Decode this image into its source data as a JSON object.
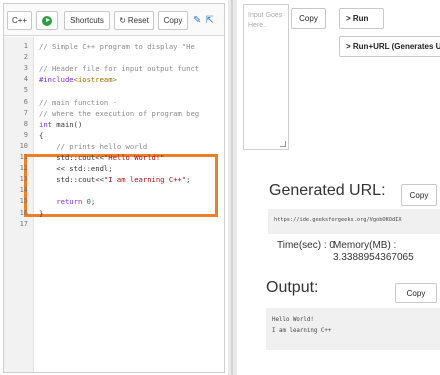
{
  "editor": {
    "toolbar": {
      "language_label": "C++",
      "shortcuts_label": "Shortcuts",
      "reset_label": "Reset",
      "copy_label": "Copy"
    },
    "lines": [
      {
        "num": "1",
        "text": "// Simple C++ program to display \"He"
      },
      {
        "num": "2",
        "text": ""
      },
      {
        "num": "3",
        "text": "// Header file for input output funct"
      },
      {
        "num": "4",
        "text": "#include<iostream>"
      },
      {
        "num": "5",
        "text": ""
      },
      {
        "num": "6",
        "text": "// main function -"
      },
      {
        "num": "7",
        "text": "// where the execution of program beg"
      },
      {
        "num": "8",
        "text": "int main()"
      },
      {
        "num": "9",
        "text": "{"
      },
      {
        "num": "10",
        "text": "    // prints hello world"
      },
      {
        "num": "11",
        "text": "    std::cout<<\"Hello World!\""
      },
      {
        "num": "12",
        "text": "    << std::endl;"
      },
      {
        "num": "13",
        "text": "    std::cout<<\"I am learning C++\";"
      },
      {
        "num": "14",
        "text": ""
      },
      {
        "num": "15",
        "text": "    return 0;"
      },
      {
        "num": "16",
        "text": "}"
      },
      {
        "num": "17",
        "text": ""
      }
    ]
  },
  "input": {
    "placeholder": "Input Goes Here..",
    "copy_label": "Copy"
  },
  "run": {
    "run_label": "> Run",
    "run_url_label": "> Run+URL (Generates U"
  },
  "generated_url": {
    "title": "Generated URL:",
    "copy_label": "Copy",
    "url": "https://ide.geeksforgeeks.org/VgobOKOdIX"
  },
  "stats": {
    "time_label": "Time(sec) : 0",
    "memory_label": "Memory(MB) :",
    "memory_value": "3.3388954367065"
  },
  "output": {
    "title": "Output:",
    "copy_label": "Copy",
    "lines": [
      "Hello World!",
      "I am learning C++"
    ]
  },
  "colors": {
    "highlight_border": "#f07e26",
    "run_icon": "#2e9e44"
  }
}
